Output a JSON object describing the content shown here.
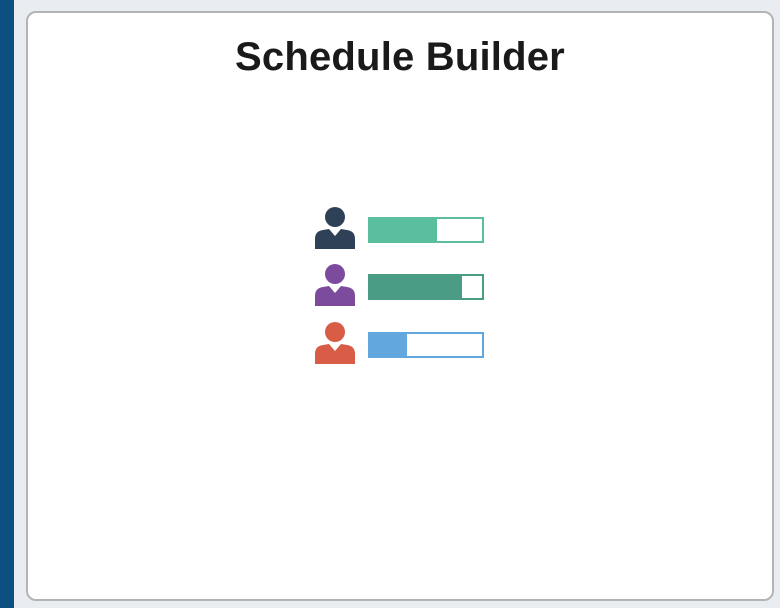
{
  "tile": {
    "title": "Schedule Builder"
  },
  "graphic": {
    "rows": [
      {
        "icon": "person-icon",
        "person_color": "#2f4157",
        "bar_color": "#5bbf9f",
        "border_color": "#5bbf9f",
        "fill_fraction": 0.6
      },
      {
        "icon": "person-icon",
        "person_color": "#7c4b9e",
        "bar_color": "#4a9c85",
        "border_color": "#4a9c85",
        "fill_fraction": 0.82
      },
      {
        "icon": "person-icon",
        "person_color": "#d95c47",
        "bar_color": "#62a8de",
        "border_color": "#62a8de",
        "fill_fraction": 0.33
      }
    ]
  }
}
